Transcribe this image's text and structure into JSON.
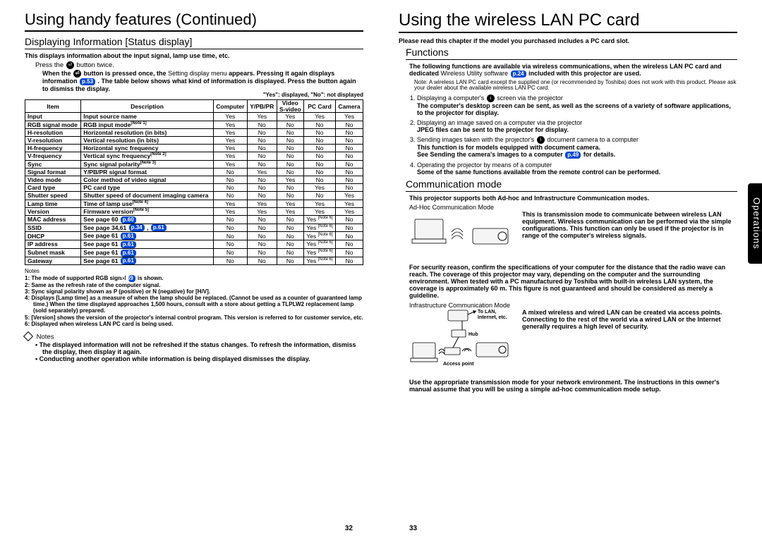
{
  "left": {
    "h1": "Using handy features (Continued)",
    "h2": "Displaying Information [Status display]",
    "intro": "This displays information about the input signal, lamp use time, etc.",
    "press": "Press the",
    "press2": "button twice.",
    "para1a": "When the",
    "para1b": "button is pressed once, the",
    "para1c": "Setting display menu",
    "para1d": "appears. Pressing it again displays information",
    "para1e": ". The table below shows what kind of information is displayed. Press the button again to dismiss the display.",
    "pill53": "p.53",
    "legend": "\"Yes\": displayed, \"No\": not displayed",
    "th": [
      "Item",
      "Description",
      "Computer",
      "Y/PB/PR",
      "Video S-video",
      "PC Card",
      "Camera"
    ],
    "rows": [
      [
        "Input",
        "Input source name",
        "Yes",
        "Yes",
        "Yes",
        "Yes",
        "Yes"
      ],
      [
        "RGB signal mode",
        "RGB input mode[Note 1]",
        "Yes",
        "No",
        "No",
        "No",
        "No"
      ],
      [
        "H-resolution",
        "Horizontal resolution (in bits)",
        "Yes",
        "No",
        "No",
        "No",
        "No"
      ],
      [
        "V-resolution",
        "Vertical resolution (in bits)",
        "Yes",
        "No",
        "No",
        "No",
        "No"
      ],
      [
        "H-frequency",
        "Horizontal sync frequency",
        "Yes",
        "No",
        "No",
        "No",
        "No"
      ],
      [
        "V-frequency",
        "Vertical sync frequency[Note 2]",
        "Yes",
        "No",
        "No",
        "No",
        "No"
      ],
      [
        "Sync",
        "Sync signal polarity[Note 3]",
        "Yes",
        "No",
        "No",
        "No",
        "No"
      ],
      [
        "Signal format",
        "Y/PB/PR signal format",
        "No",
        "Yes",
        "No",
        "No",
        "No"
      ],
      [
        "Video mode",
        "Color method of video signal",
        "No",
        "No",
        "Yes",
        "No",
        "No"
      ],
      [
        "Card type",
        "PC card type",
        "No",
        "No",
        "No",
        "Yes",
        "No"
      ],
      [
        "Shutter speed",
        "Shutter speed of document imaging camera",
        "No",
        "No",
        "No",
        "No",
        "Yes"
      ],
      [
        "Lamp time",
        "Time of lamp use[Note 4]",
        "Yes",
        "Yes",
        "Yes",
        "Yes",
        "Yes"
      ],
      [
        "Version",
        "Firmware version[Note 5]",
        "Yes",
        "Yes",
        "Yes",
        "Yes",
        "Yes"
      ],
      [
        "MAC address",
        "See page 60 p.60",
        "No",
        "No",
        "No",
        "Yes [Note 6]",
        "No"
      ],
      [
        "SSID",
        "See page 34,61 p.34 , p.61",
        "No",
        "No",
        "No",
        "Yes [Note 6]",
        "No"
      ],
      [
        "DHCP",
        "See page 61 p.61",
        "No",
        "No",
        "No",
        "Yes [Note 6]",
        "No"
      ],
      [
        "IP address",
        "See page 61 p.61",
        "No",
        "No",
        "No",
        "Yes [Note 6]",
        "No"
      ],
      [
        "Subnet mask",
        "See page 61 p.61",
        "No",
        "No",
        "No",
        "Yes [Note 6]",
        "No"
      ],
      [
        "Gateway",
        "See page 61 p.61",
        "No",
        "No",
        "No",
        "Yes [Note 6]",
        "No"
      ]
    ],
    "notes_label": "Notes",
    "notes": [
      "1: The mode of supported RGB signal p.69 is shown.",
      "2: Same as the refresh rate of the computer signal.",
      "3: Sync signal polarity shown as P (positive) or N (negative) for [H/V].",
      "4: Displays [Lamp time] as a measure of when the lamp should be replaced. (Cannot be used as a counter of guaranteed lamp time.) When the time displayed approaches 1,500 hours, consult with a store about getting a TLPLW2 replacement lamp (sold separately) prepared.",
      "5: [Version] shows the version of the projector's internal control program. This version is referred to for customer service, etc.",
      "6: Displayed when wireless LAN PC card is being used."
    ],
    "notes2_label": "Notes",
    "bullets": [
      "The displayed information will not be refreshed if the status changes. To refresh the information, dismiss the display, then display it again.",
      "Conducting another operation while information is being displayed dismisses the display."
    ],
    "pagenum": "32"
  },
  "right": {
    "h1": "Using the wireless LAN PC card",
    "top_note": "Please read this chapter if the model you purchased includes a PC card slot.",
    "h2a": "Functions",
    "func_intro_a": "The following functions are available via wireless communications, when the wireless LAN PC card and dedicated",
    "func_intro_b": "Wireless Utility software",
    "func_intro_c": "included with this projector are used.",
    "pill24": "p.24",
    "note_box": "Note: A wireless LAN PC card except the supplied one (or recommended by Toshiba) does not work with this product. Please ask your dealer about the available wireless LAN PC card.",
    "fn1a": "Displaying a computer's",
    "fn1b": "screen via the projector",
    "fn1c": "The computer's desktop screen can be sent, as well as the screens of a variety of software applications, to the projector for display.",
    "fn2a": "Displaying an image saved on a computer via the projector",
    "fn2b": "JPEG files can be sent to the projector for display.",
    "fn3a": "Sending images taken with the projector's",
    "fn3b": "document camera to a computer",
    "fn3c": "This function is for models equipped with document camera.",
    "fn3d": "See Sending the camera's images to a computer",
    "fn3e": "for details.",
    "pill49": "p.49",
    "fn4a": "Operating the projector by means of a computer",
    "fn4b": "Some of the same functions available from the remote control can be performed.",
    "h2b": "Communication mode",
    "comm_intro": "This projector supports both Ad-hoc and Infrastructure Communication modes.",
    "adhoc_label": "Ad-Hoc Communication Mode",
    "adhoc_text": "This is transmission mode to communicate between wireless LAN equipment. Wireless communication can be performed via the simple configurations. This function can only be used if the projector is in range of the computer's wireless signals.",
    "security": "For security reason, confirm the specifications of your computer for the distance that the radio wave can reach. The coverage of this projector may vary, depending on the computer and the surrounding environment. When tested with a PC manufactured by Toshiba with built-in wireless LAN system, the coverage is approximately 60 m. This figure is not guaranteed and should be considered as merely a guideline.",
    "infra_label": "Infrastructure Communication Mode",
    "infra_text": "A mixed wireless and wired LAN can be created via access points. Connecting to the rest of the world via a wired LAN or the Internet generally requires a high level of security.",
    "to_lan": "To LAN, Internet, etc.",
    "hub": "Hub",
    "ap": "Access point",
    "closing": "Use the appropriate transmission mode for your network environment. The instructions in this owner's manual assume that you will be using a simple ad-hoc communication mode setup.",
    "pagenum": "33",
    "sidetab": "Operations"
  }
}
